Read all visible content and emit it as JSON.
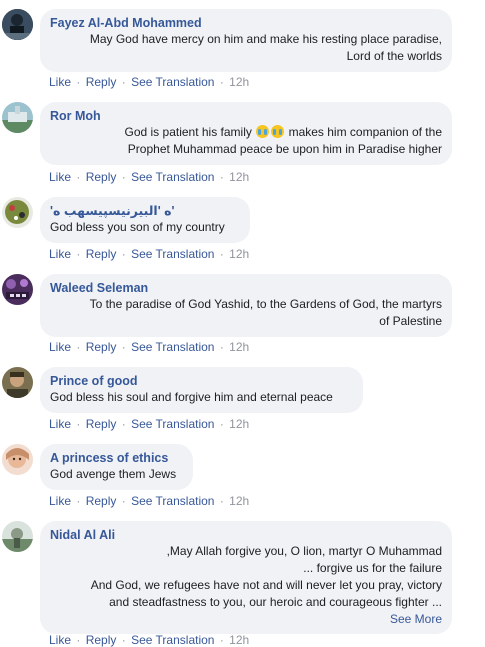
{
  "actions": {
    "like": "Like",
    "reply": "Reply",
    "translate": "See Translation",
    "sep": "·"
  },
  "comments": [
    {
      "author": "Fayez Al-Abd Mohammed",
      "lines": [
        "May God have mercy on him and make his resting place paradise,",
        "Lord of the worlds"
      ],
      "time": "12h",
      "avatar_color": "#2a3b4c"
    },
    {
      "author": "Ror Moh",
      "lines_pre": "God is patient his family",
      "lines_post": "makes him companion of the",
      "line2": "Prophet Muhammad peace be upon him in Paradise higher",
      "time": "12h",
      "avatar_color": "#7fa8b8"
    },
    {
      "author": "'ه 'البيرنيسپيسهب ه'",
      "lines": [
        "God bless you son of my country"
      ],
      "time": "12h",
      "avatar_color": "#6b7a3a"
    },
    {
      "author": "Waleed Seleman",
      "lines": [
        "To the paradise of God Yashid, to the Gardens of God, the martyrs",
        "of Palestine"
      ],
      "time": "12h",
      "avatar_color": "#4a2d5c"
    },
    {
      "author": "Prince of good",
      "lines": [
        "God bless his soul and forgive him and eternal peace"
      ],
      "time": "12h",
      "avatar_color": "#5a5238"
    },
    {
      "author": "A princess of ethics",
      "lines": [
        "God avenge them Jews"
      ],
      "time": "12h",
      "avatar_color": "#e8c8b0"
    },
    {
      "author": "Nidal Al Ali",
      "lines": [
        ",May Allah forgive you, O lion, martyr O Muhammad",
        "... forgive us for the failure",
        "And God, we refugees have not and will never let you pray, victory",
        "and steadfastness to you, our heroic and courageous fighter ..."
      ],
      "see_more": "See More",
      "time": "12h",
      "avatar_color": "#6f8a6a"
    }
  ]
}
